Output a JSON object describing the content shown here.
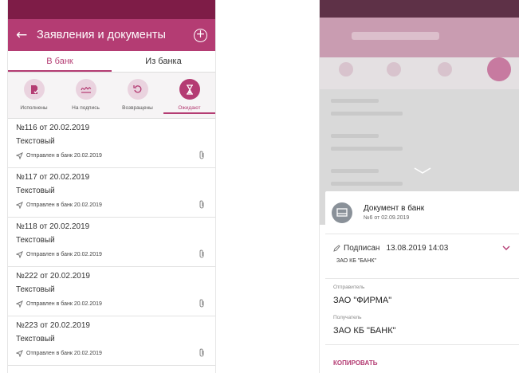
{
  "left": {
    "title": "Заявления и документы",
    "tabs": [
      "В банк",
      "Из банка"
    ],
    "filters": [
      "Исполнены",
      "На подпись",
      "Возвращены",
      "Ожидают"
    ],
    "documents": [
      {
        "number": "№116 от 20.02.2019",
        "type": "Текстовый",
        "status": "Отправлен в банк 20.02.2019"
      },
      {
        "number": "№117 от 20.02.2019",
        "type": "Текстовый",
        "status": "Отправлен в банк 20.02.2019"
      },
      {
        "number": "№118 от 20.02.2019",
        "type": "Текстовый",
        "status": "Отправлен в банк 20.02.2019"
      },
      {
        "number": "№222 от 20.02.2019",
        "type": "Текстовый",
        "status": "Отправлен в банк 20.02.2019"
      },
      {
        "number": "№223 от 20.02.2019",
        "type": "Текстовый",
        "status": "Отправлен в банк 20.02.2019"
      }
    ]
  },
  "right": {
    "sheet_title": "Документ в банк",
    "sheet_subtitle": "№6 от 02.09.2019",
    "sign_status": "Подписан",
    "sign_datetime": "13.08.2019 14:03",
    "signer": "ЗАО КБ \"БАНК\"",
    "sender_label": "Отправитель",
    "sender_value": "ЗАО \"ФИРМА\"",
    "recipient_label": "Получатель",
    "recipient_value": "ЗАО КБ \"БАНК\"",
    "copy_label": "КОПИРОВАТЬ"
  },
  "colors": {
    "accent": "#b43c73",
    "status_bar": "#7e1c47"
  }
}
